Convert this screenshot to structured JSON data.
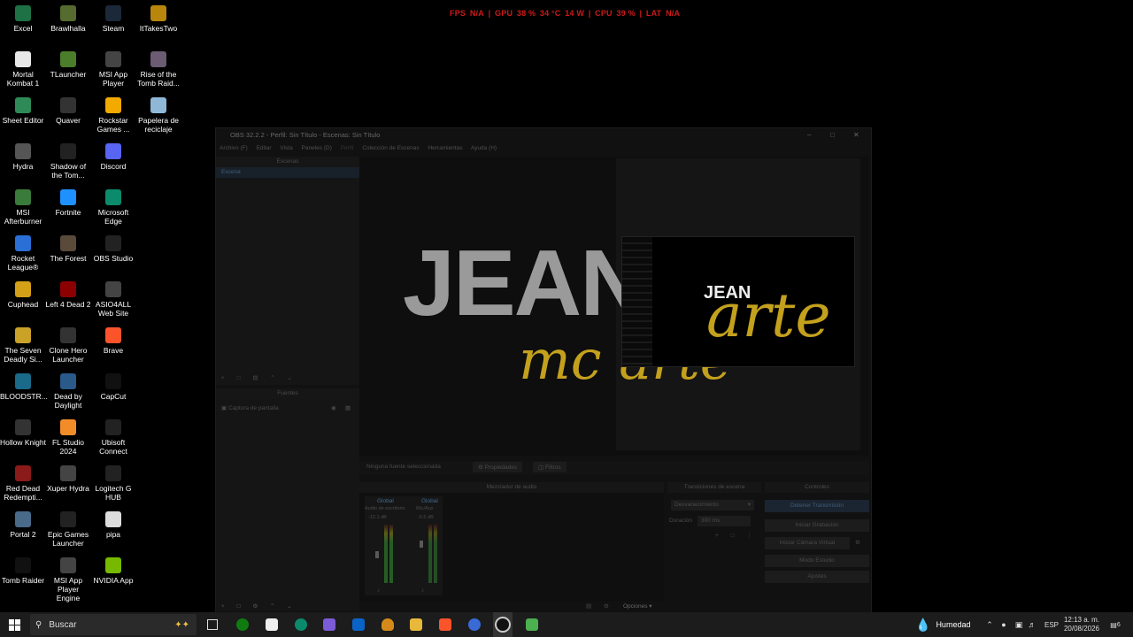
{
  "stats": {
    "fps_label": "FPS",
    "fps": "N/A",
    "gpu_label": "GPU",
    "gpu_pct": "38 %",
    "gpu_temp": "34 °C",
    "gpu_power": "14 W",
    "cpu_label": "CPU",
    "cpu_pct": "39 %",
    "lat_label": "LAT",
    "lat": "N/A",
    "sep": "|"
  },
  "desktop": [
    {
      "label": "Excel",
      "icon": "excel-icon",
      "color": "#1e7145"
    },
    {
      "label": "Brawlhalla",
      "icon": "brawlhalla-icon",
      "color": "#556b2f"
    },
    {
      "label": "Steam",
      "icon": "steam-icon",
      "color": "#1b2838"
    },
    {
      "label": "ItTakesTwo",
      "icon": "ittakestwo-icon",
      "color": "#b8860b"
    },
    {
      "label": "Mortal Kombat 1",
      "icon": "file-icon",
      "color": "#e8e8e8"
    },
    {
      "label": "TLauncher",
      "icon": "tlauncher-icon",
      "color": "#4b7d2a"
    },
    {
      "label": "MSI App Player",
      "icon": "msi-icon",
      "color": "#444"
    },
    {
      "label": "Rise of the Tomb Raid...",
      "icon": "tombraider-icon",
      "color": "#6b5b73"
    },
    {
      "label": "Sheet Editor",
      "icon": "sheet-icon",
      "color": "#2e8b57"
    },
    {
      "label": "Quaver",
      "icon": "quaver-icon",
      "color": "#333"
    },
    {
      "label": "Rockstar Games ...",
      "icon": "rockstar-icon",
      "color": "#f2a900"
    },
    {
      "label": "Papelera de reciclaje",
      "icon": "recycle-bin-icon",
      "color": "#8fb8d8"
    },
    {
      "label": "Hydra",
      "icon": "hydra-icon",
      "color": "#555"
    },
    {
      "label": "Shadow of the Tom...",
      "icon": "shadow-icon",
      "color": "#222"
    },
    {
      "label": "Discord",
      "icon": "discord-icon",
      "color": "#5865f2"
    },
    {
      "label": "MSI Afterburner",
      "icon": "afterburner-icon",
      "color": "#3a7a3a"
    },
    {
      "label": "Fortnite",
      "icon": "fortnite-icon",
      "color": "#1e90ff"
    },
    {
      "label": "Microsoft Edge",
      "icon": "edge-icon",
      "color": "#0c8a6c"
    },
    {
      "label": "Rocket League®",
      "icon": "rocketleague-icon",
      "color": "#2a6fd6"
    },
    {
      "label": "The Forest",
      "icon": "forest-icon",
      "color": "#5a4a3a"
    },
    {
      "label": "OBS Studio",
      "icon": "obs-icon",
      "color": "#222"
    },
    {
      "label": "Cuphead",
      "icon": "cuphead-icon",
      "color": "#d4a017"
    },
    {
      "label": "Left 4 Dead 2",
      "icon": "l4d2-icon",
      "color": "#8b0000"
    },
    {
      "label": "ASIO4ALL Web Site",
      "icon": "asio-icon",
      "color": "#444"
    },
    {
      "label": "The Seven Deadly Si...",
      "icon": "sevendeadly-icon",
      "color": "#c9a227"
    },
    {
      "label": "Clone Hero Launcher",
      "icon": "clonehero-icon",
      "color": "#333"
    },
    {
      "label": "Brave",
      "icon": "brave-icon",
      "color": "#fb542b"
    },
    {
      "label": "BLOODSTR...",
      "icon": "bloodstrike-icon",
      "color": "#1a6a8a"
    },
    {
      "label": "Dead by Daylight",
      "icon": "dbd-icon",
      "color": "#2a5a8a"
    },
    {
      "label": "CapCut",
      "icon": "capcut-icon",
      "color": "#111"
    },
    {
      "label": "Hollow Knight",
      "icon": "hollowknight-icon",
      "color": "#333"
    },
    {
      "label": "FL Studio 2024",
      "icon": "flstudio-icon",
      "color": "#f28c28"
    },
    {
      "label": "Ubisoft Connect",
      "icon": "ubisoft-icon",
      "color": "#222"
    },
    {
      "label": "Red Dead Redempti...",
      "icon": "rdr-icon",
      "color": "#8b1a1a"
    },
    {
      "label": "Xuper Hydra",
      "icon": "xuperhydra-icon",
      "color": "#444"
    },
    {
      "label": "Logitech G HUB",
      "icon": "logitech-icon",
      "color": "#222"
    },
    {
      "label": "Portal 2",
      "icon": "portal-icon",
      "color": "#4a6a8a"
    },
    {
      "label": "Epic Games Launcher",
      "icon": "epic-icon",
      "color": "#222"
    },
    {
      "label": "pipa",
      "icon": "file-icon",
      "color": "#ddd"
    },
    {
      "label": "Tomb Raider",
      "icon": "tr-icon",
      "color": "#111"
    },
    {
      "label": "MSI App Player Engine",
      "icon": "msi-icon",
      "color": "#444"
    },
    {
      "label": "NVIDIA App",
      "icon": "nvidia-icon",
      "color": "#76b900"
    }
  ],
  "obs": {
    "title": "OBS 32.2.2 - Perfil: Sin Título - Escenas: Sin Título",
    "menu": [
      "Archivo (F)",
      "Editar",
      "Vista",
      "Paneles (D)",
      "Perfil",
      "Colección de Escenas",
      "Herramientas",
      "Ayuda (H)"
    ],
    "scenes_header": "Escenas",
    "scene_item": "Escena",
    "sources_header": "Fuentes",
    "source_item": "Captura de pantalla",
    "no_source": "Ninguna fuente seleccionada",
    "properties": "Propiedades",
    "filters": "Filtros",
    "mixer_header": "Mezclador de audio",
    "transitions_header": "Transiciones de escena",
    "controls_header": "Controles",
    "channel1": {
      "label": "Global",
      "name": "Audio de escritorio",
      "db": "-12.1 dB"
    },
    "channel2": {
      "label": "Global",
      "name": "Mic/Aux",
      "db": "-5.5 dB"
    },
    "meter_ticks": [
      "0",
      "-5",
      "-10",
      "-15",
      "-20",
      "-25",
      "-30",
      "-35",
      "-40",
      "-45",
      "-50",
      "-55",
      "-60"
    ],
    "transition": "Desvanecimiento",
    "duration_label": "Duración",
    "duration_value": "300 ms",
    "controls": [
      "Detener Transmisión",
      "Iniciar Grabación",
      "Iniciar Cámara Virtual",
      "Modo Estudio",
      "Ajustes"
    ],
    "options": "Opciones",
    "preview_text": "JEAN",
    "preview_script": "mc arte"
  },
  "taskbar": {
    "search_placeholder": "Buscar",
    "weather": "Humedad",
    "lang": "ESP",
    "time": "12:13 a. m.",
    "date": "20/08/2026",
    "notif_count": "6"
  }
}
